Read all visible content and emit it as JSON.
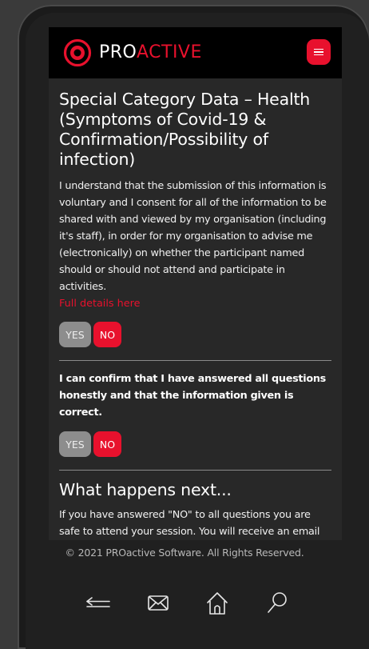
{
  "header": {
    "logo_pro": "PRO",
    "logo_active": "ACTIVE",
    "menu_icon": "hamburger-icon"
  },
  "health_section": {
    "title": "Special Category Data – Health (Symptoms of Covid-19 & Confirmation/Possibility of infection)",
    "consent_text": "I understand that the submission of this information is voluntary and I consent for all of the information to be shared with and viewed by my organisation (including it's staff), in order for my organisation to advise me (electronically) on whether the participant named should or should not attend and participate in activities.",
    "details_link": "Full details here",
    "yes_label": "YES",
    "no_label": "NO"
  },
  "confirm_section": {
    "text": "I can confirm that I have answered all questions honestly and that the information given is correct.",
    "yes_label": "YES",
    "no_label": "NO"
  },
  "next_section": {
    "title": "What happens next...",
    "text": "If you have answered \"NO\" to all questions you are safe to attend your session. You will receive an email confirming this and your organisation will have a record."
  },
  "footer": {
    "copyright": "© 2021 PROactive Software. All Rights Reserved."
  },
  "device_nav": {
    "icons": [
      "back-icon",
      "mail-icon",
      "home-icon",
      "search-icon"
    ]
  },
  "colors": {
    "accent": "#e8112d",
    "header_bg": "#000000",
    "content_bg": "#282828",
    "yes_button": "#8d8d8d"
  }
}
